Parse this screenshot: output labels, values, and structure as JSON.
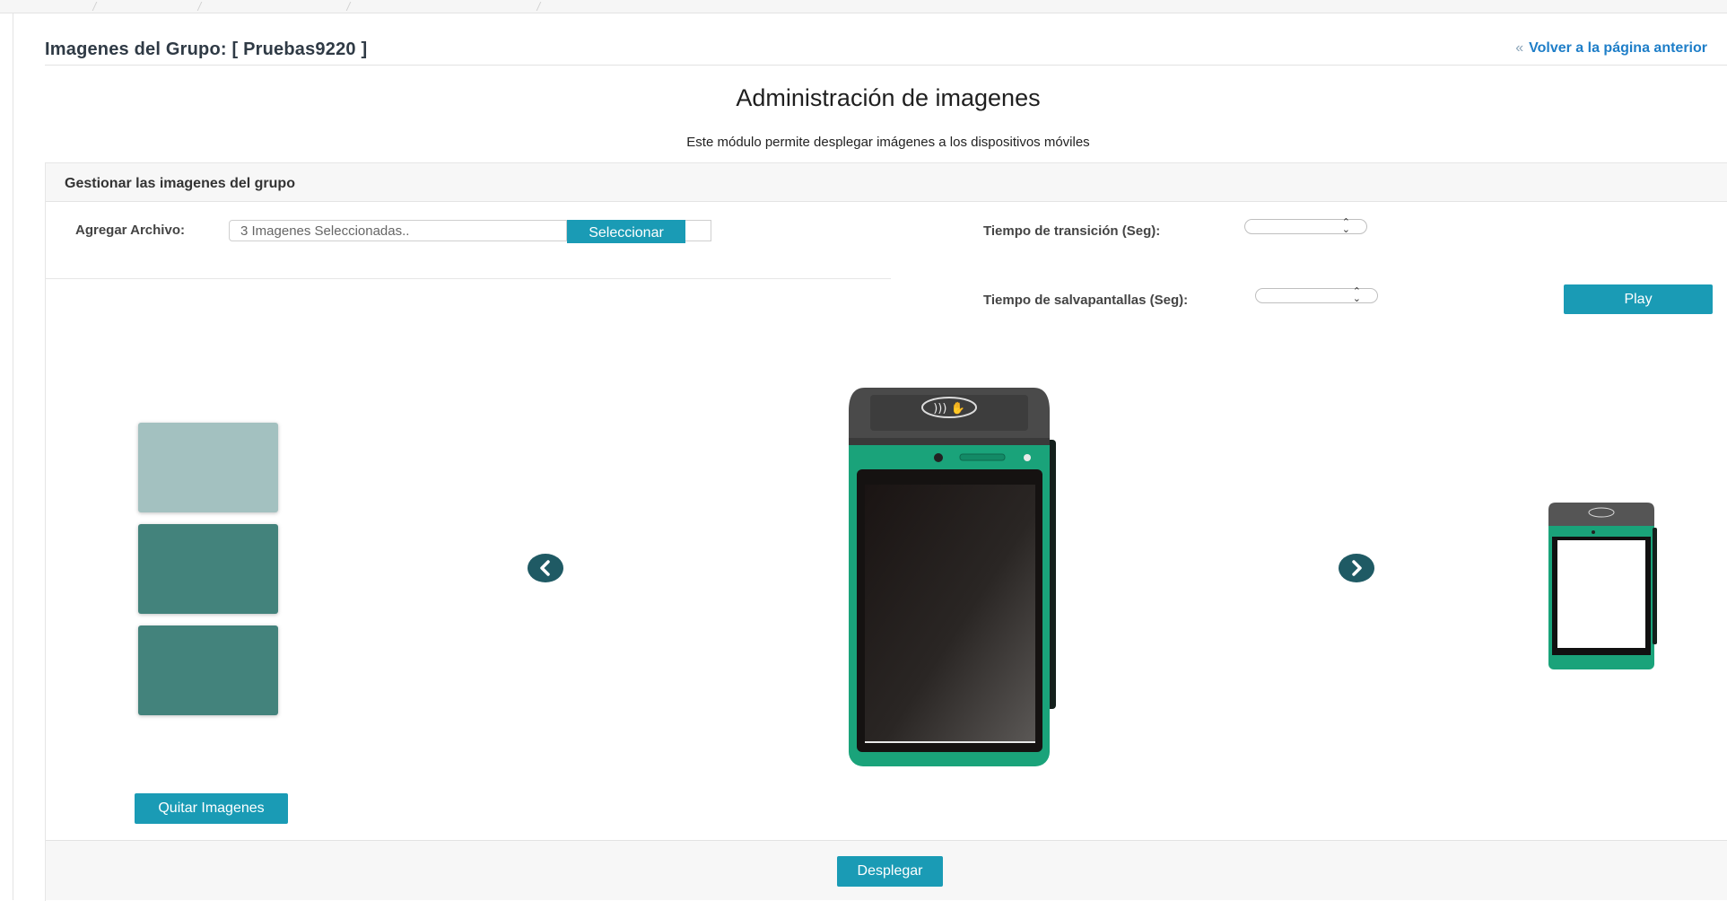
{
  "header": {
    "group_title": "Imagenes del Grupo: [ Pruebas9220 ]",
    "back_link_chevron": "«",
    "back_link_label": "Volver a la página anterior"
  },
  "main": {
    "heading": "Administración de imagenes",
    "subtitle": "Este módulo permite desplegar imágenes a los dispositivos móviles"
  },
  "panel": {
    "title": "Gestionar las imagenes del grupo",
    "add_file_label": "Agregar Archivo:",
    "file_input_value": "3 Imagenes Seleccionadas..",
    "select_button": "Seleccionar",
    "transition_label": "Tiempo de transición (Seg):",
    "screensaver_label": "Tiempo de salvapantallas (Seg):",
    "play_button": "Play",
    "remove_button": "Quitar Imagenes",
    "deploy_button": "Desplegar"
  },
  "thumbnails": [
    {
      "color": "#a3c1c0"
    },
    {
      "color": "#43837c"
    },
    {
      "color": "#43837c"
    }
  ],
  "colors": {
    "accent": "#1a9bb5",
    "link": "#1e7ec8",
    "arrow": "#1f5a64",
    "device_green": "#1aa37a",
    "device_top": "#4a4a4a"
  },
  "icons": {
    "prev": "chevron-left-icon",
    "next": "chevron-right-icon",
    "nfc": "contactless-icon",
    "spinner": "up-down-spinner-icon"
  }
}
